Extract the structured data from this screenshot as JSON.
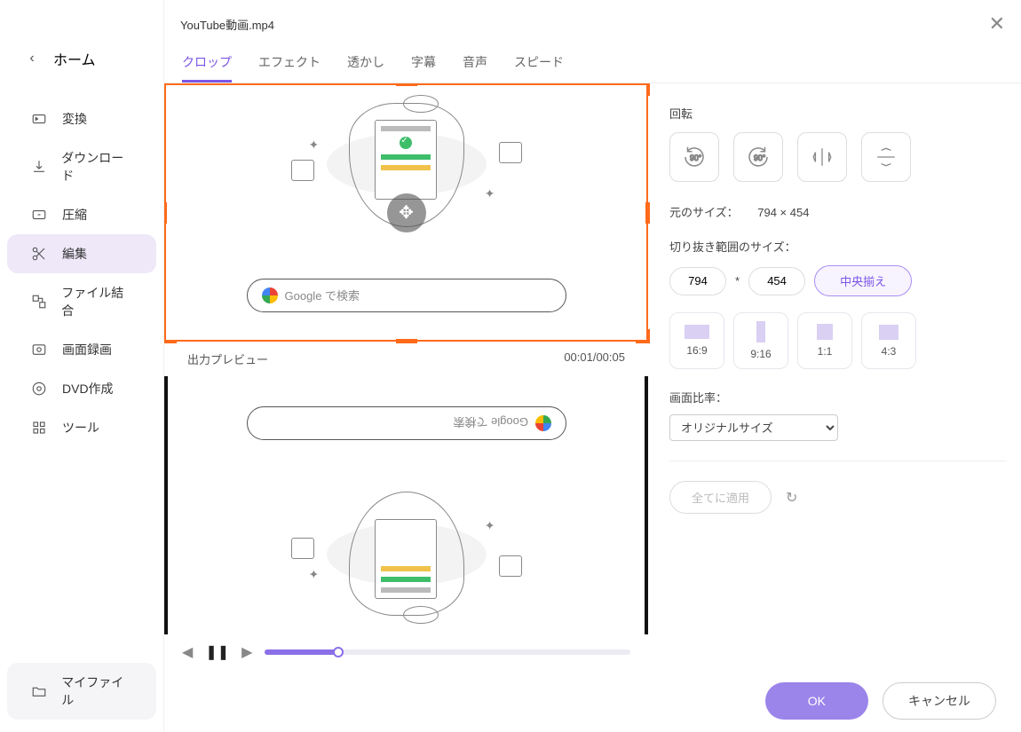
{
  "title": "YouTube動画.mp4",
  "sidebar": {
    "home": "ホーム",
    "items": [
      "変換",
      "ダウンロード",
      "圧縮",
      "編集",
      "ファイル結合",
      "画面録画",
      "DVD作成",
      "ツール"
    ],
    "myfile": "マイファイル"
  },
  "tabs": [
    "クロップ",
    "エフェクト",
    "透かし",
    "字幕",
    "音声",
    "スピード"
  ],
  "activeTab": 0,
  "preview": {
    "label": "出力プレビュー",
    "time": "00:01/00:05",
    "search": "Google で検索"
  },
  "settings": {
    "rotationLabel": "回転",
    "origLabel": "元のサイズ：",
    "origVal": "794 × 454",
    "cropLabel": "切り抜き範囲のサイズ：",
    "cropW": "794",
    "cropH": "454",
    "centerBtn": "中央揃え",
    "ratios": [
      "16:9",
      "9:16",
      "1:1",
      "4:3"
    ],
    "aspectLabel": "画面比率：",
    "aspectSelected": "オリジナルサイズ",
    "applyAll": "全てに適用"
  },
  "footer": {
    "ok": "OK",
    "cancel": "キャンセル"
  }
}
